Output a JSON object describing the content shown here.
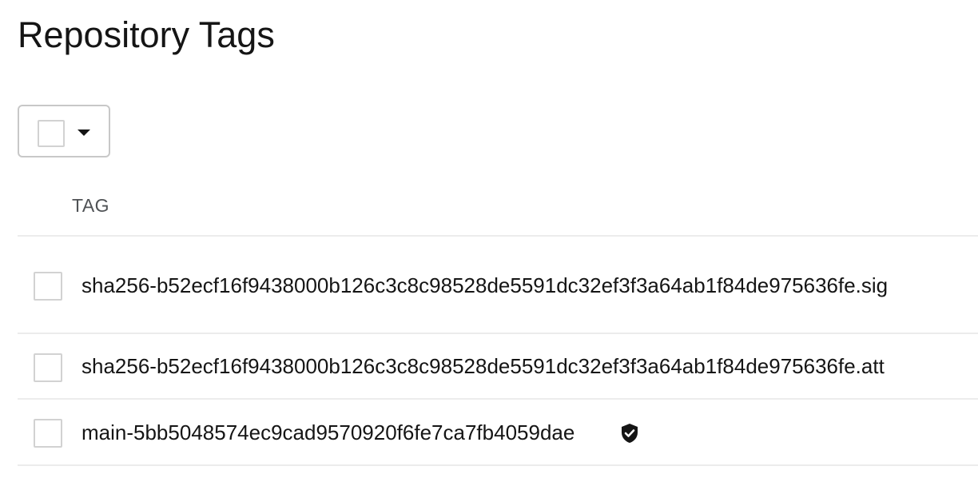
{
  "page": {
    "title": "Repository Tags"
  },
  "bulk_select": {
    "checked": false,
    "icon": "caret-down-icon"
  },
  "table": {
    "columns": [
      "TAG"
    ],
    "rows": [
      {
        "tag": "sha256-b52ecf16f9438000b126c3c8c98528de5591dc32ef3f3a64ab1f84de975636fe.sig",
        "checked": false,
        "signed": false
      },
      {
        "tag": "sha256-b52ecf16f9438000b126c3c8c98528de5591dc32ef3f3a64ab1f84de975636fe.att",
        "checked": false,
        "signed": false
      },
      {
        "tag": "main-5bb5048574ec9cad9570920f6fe7ca7fb4059dae",
        "checked": false,
        "signed": true,
        "signed_icon": "shield-check-icon"
      }
    ]
  },
  "colors": {
    "text": "#151515",
    "muted": "#4f5255",
    "border": "#d2d2d2",
    "divider": "#ececec"
  }
}
